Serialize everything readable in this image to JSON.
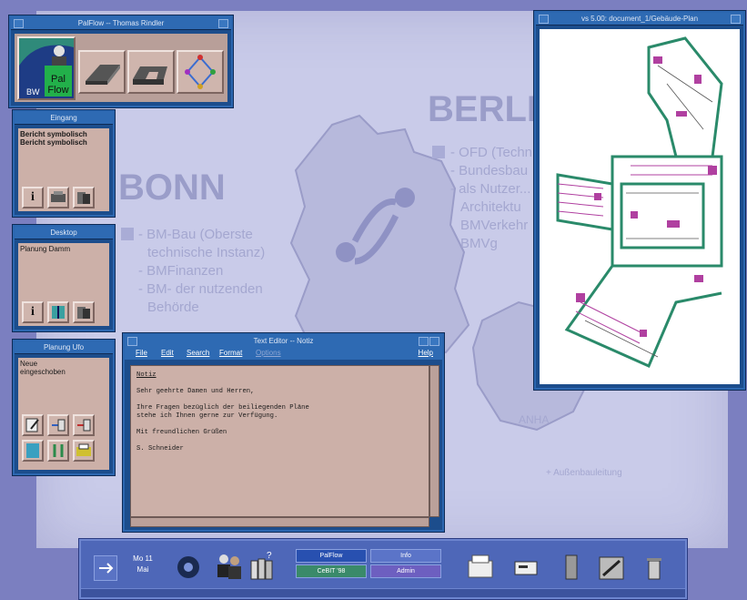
{
  "palflow_window": {
    "title": "PalFlow -- Thomas Rindler",
    "logo_text": "Pal Flow"
  },
  "eingang_window": {
    "title": "Eingang",
    "items": [
      "Bericht symbolisch",
      "Bericht symbolisch"
    ]
  },
  "desktop_window": {
    "title": "Desktop",
    "items": [
      "Planung Damm"
    ]
  },
  "planung_window": {
    "title": "Planung Ufo",
    "items": [
      "Neue",
      "eingeschoben"
    ]
  },
  "text_editor": {
    "title": "Text Editor -- Notiz",
    "menu": [
      "File",
      "Edit",
      "Search",
      "Format",
      "Options"
    ],
    "help": "Help",
    "lines": [
      "Notiz",
      "",
      "Sehr geehrte Damen und Herren,",
      "",
      "Ihre Fragen bezüglich der beiliegenden Pläne",
      "stehe ich Ihnen gerne zur Verfügung.",
      "",
      "Mit freundlichen Grüßen",
      "",
      "S. Schneider"
    ]
  },
  "cad_window": {
    "title": "vs 5.00: document_1/Gebäude-Plan"
  },
  "wallpaper": {
    "bonn_title": "BONN",
    "berlin_title": "BERLIN",
    "bonn_lines": [
      "- BM-Bau (Oberste",
      "technische Instanz)",
      "- BMFinanzen",
      "- BM- der nutzenden",
      "Behörde"
    ],
    "berlin_lines": [
      "- OFD (Techn",
      "- Bundesbau",
      "- als Nutzer...",
      "Architektu",
      "BMVerkehr",
      "BMVg"
    ],
    "region_label": "ANHA",
    "bottom_note": "+ Außenbauleitung"
  },
  "front_panel": {
    "date_day": "Mo 11",
    "date_month": "Mai",
    "workspaces": [
      "PalFlow",
      "Info",
      "CeBIT '98",
      "Admin"
    ]
  }
}
